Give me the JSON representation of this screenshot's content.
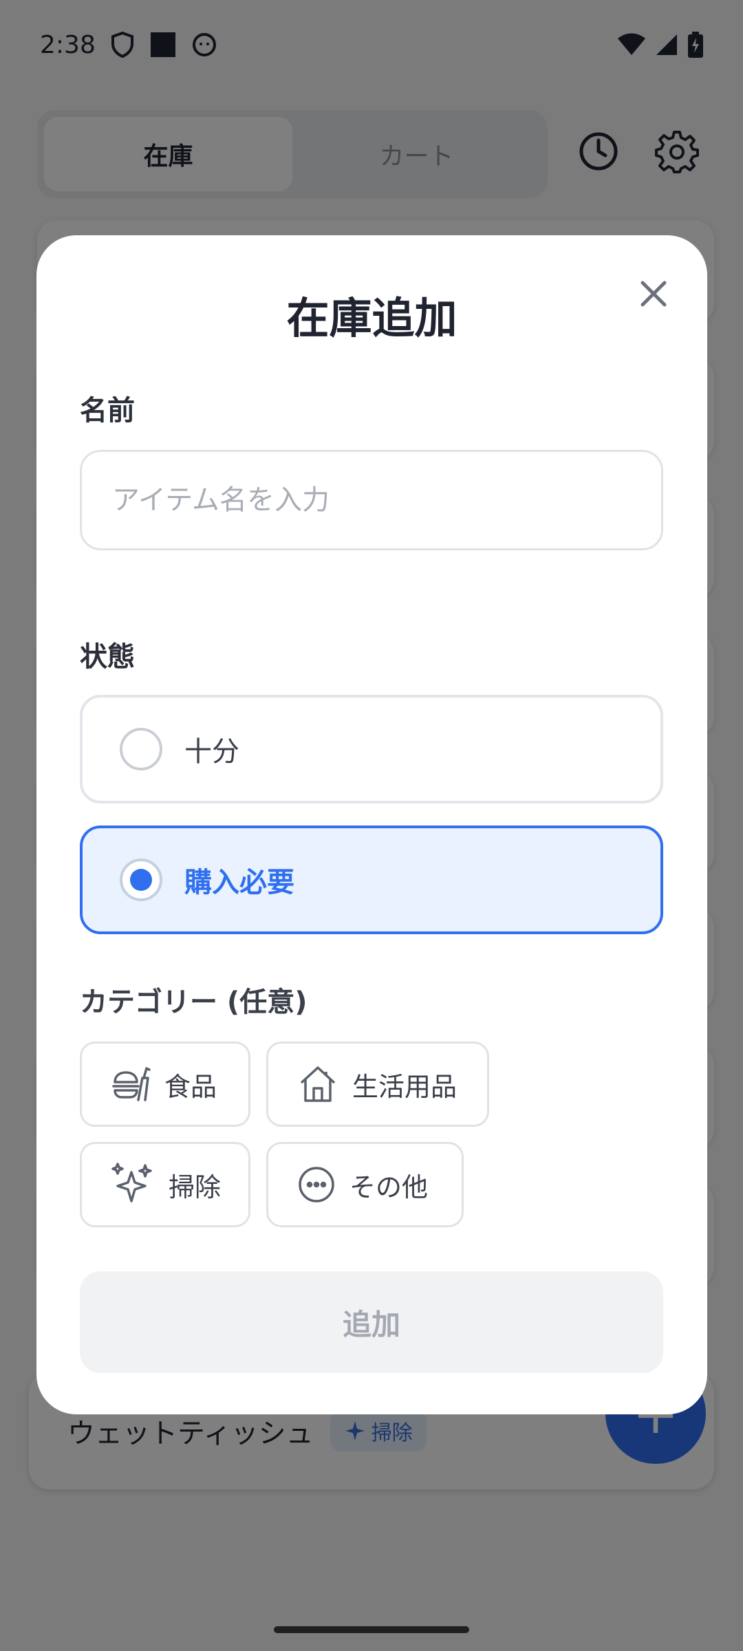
{
  "status_bar": {
    "time": "2:38"
  },
  "tabs": [
    {
      "label": "在庫",
      "active": true
    },
    {
      "label": "カート",
      "active": false
    }
  ],
  "header_icons": [
    "history-icon",
    "settings-icon"
  ],
  "background_item": {
    "name": "ウェットティッシュ",
    "category": "掃除"
  },
  "fab": {
    "label": "+"
  },
  "modal": {
    "title": "在庫追加",
    "name_label": "名前",
    "name_placeholder": "アイテム名を入力",
    "name_value": "",
    "status_label": "状態",
    "status_options": [
      {
        "label": "十分",
        "selected": false
      },
      {
        "label": "購入必要",
        "selected": true
      }
    ],
    "category_label": "カテゴリー (任意)",
    "categories": [
      {
        "label": "食品",
        "icon": "food-icon"
      },
      {
        "label": "生活用品",
        "icon": "house-icon"
      },
      {
        "label": "掃除",
        "icon": "sparkle-icon"
      },
      {
        "label": "その他",
        "icon": "more-icon"
      }
    ],
    "submit_label": "追加"
  },
  "colors": {
    "accent": "#2f6ff0",
    "selected_bg": "#e9f2fe",
    "disabled_bg": "#f1f2f4",
    "disabled_text": "#a3a8b1"
  }
}
